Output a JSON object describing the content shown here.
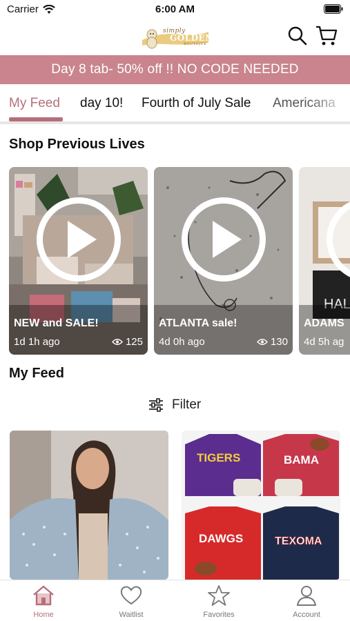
{
  "status_bar": {
    "carrier": "Carrier",
    "time": "6:00 AM"
  },
  "header": {
    "logo_text_top": "simply",
    "logo_text_main": "GOLDEN",
    "logo_text_sub": "BOUTIQUE"
  },
  "promo": {
    "text": "Day 8 tab- 50% off !! NO CODE NEEDED"
  },
  "tabs": [
    {
      "label": "My Feed",
      "active": true
    },
    {
      "label": "day 10!",
      "active": false
    },
    {
      "label": "Fourth of July Sale",
      "active": false
    },
    {
      "label": "Americana",
      "active": false
    }
  ],
  "lives_section": {
    "title": "Shop Previous Lives"
  },
  "lives": [
    {
      "title": "NEW and SALE!",
      "age": "1d 1h ago",
      "views": "125"
    },
    {
      "title": "ATLANTA sale!",
      "age": "4d 0h ago",
      "views": "130"
    },
    {
      "title": "ADAMS",
      "age": "4d 5h ag",
      "views": ""
    }
  ],
  "feed_section": {
    "title": "My Feed",
    "filter_label": "Filter"
  },
  "feed_items": [
    {
      "type": "sequin jacket"
    },
    {
      "type": "team sweatshirts",
      "labels": [
        "TIGERS",
        "BAMA",
        "DAWGS",
        "TEXOMA"
      ]
    }
  ],
  "tabbar": [
    {
      "label": "Home",
      "icon": "home-icon",
      "active": true
    },
    {
      "label": "Waitlist",
      "icon": "heart-icon",
      "active": false
    },
    {
      "label": "Favorites",
      "icon": "star-icon",
      "active": false
    },
    {
      "label": "Account",
      "icon": "person-icon",
      "active": false
    }
  ],
  "colors": {
    "accent": "#b4707a",
    "promo_bg": "#c9848d",
    "divider": "#e6e6e6"
  }
}
